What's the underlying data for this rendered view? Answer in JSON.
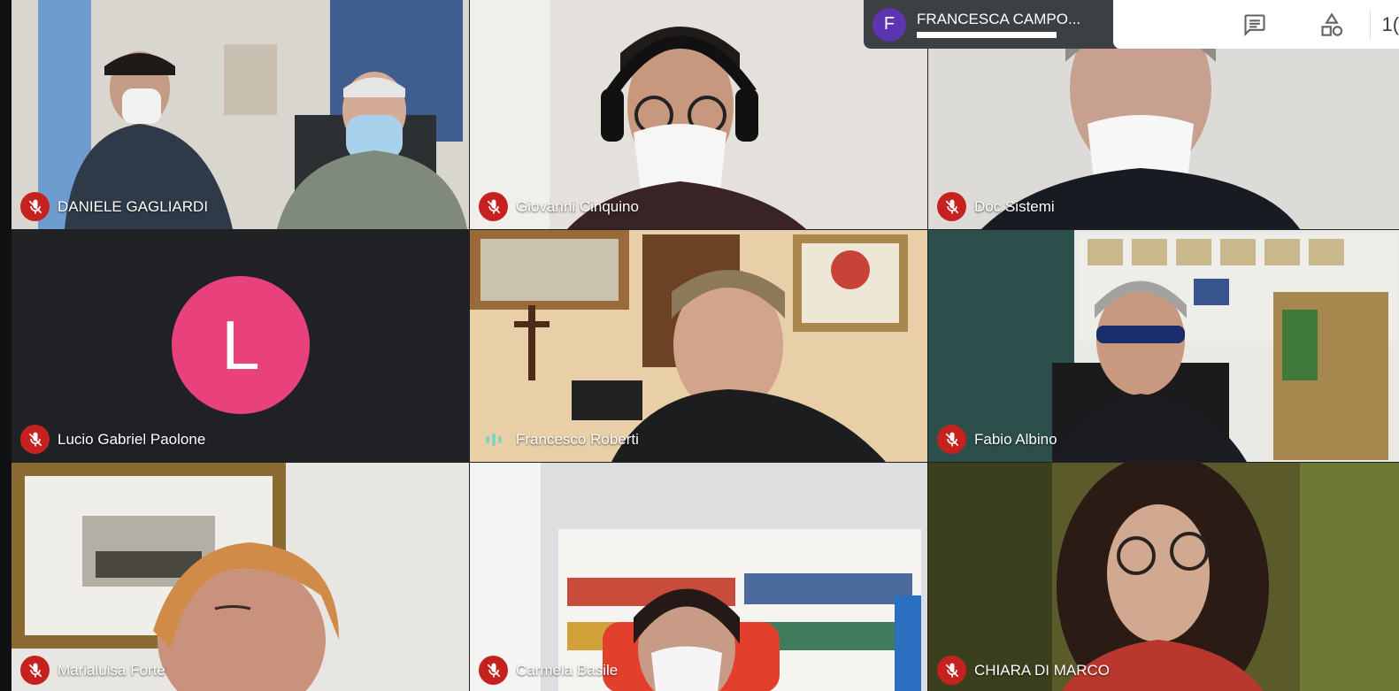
{
  "presenter": {
    "initial": "F",
    "name": "FRANCESCA CAMPO..."
  },
  "toolbar": {
    "chat_icon": "chat-icon",
    "activities_icon": "shapes-icon",
    "clock_partial": "1("
  },
  "participants": [
    {
      "name": "DANIELE GAGLIARDI",
      "muted": true
    },
    {
      "name": "Giovanni Cinquino",
      "muted": true
    },
    {
      "name": "Doc Sistemi",
      "muted": true
    },
    {
      "name": "Lucio Gabriel Paolone",
      "muted": true,
      "avatar_initial": "L",
      "avatar_color": "#e8417b"
    },
    {
      "name": "Francesco Roberti",
      "muted": false,
      "speaking": true
    },
    {
      "name": "Fabio Albino",
      "muted": true
    },
    {
      "name": "Marialuisa Forte",
      "muted": true
    },
    {
      "name": "Carmela Basile",
      "muted": true
    },
    {
      "name": "CHIARA DI MARCO",
      "muted": true
    }
  ],
  "colors": {
    "mic_off": "#c5221f",
    "speaking": "#7fd5c0",
    "background": "#202124",
    "presenter_avatar": "#5e35b1"
  }
}
